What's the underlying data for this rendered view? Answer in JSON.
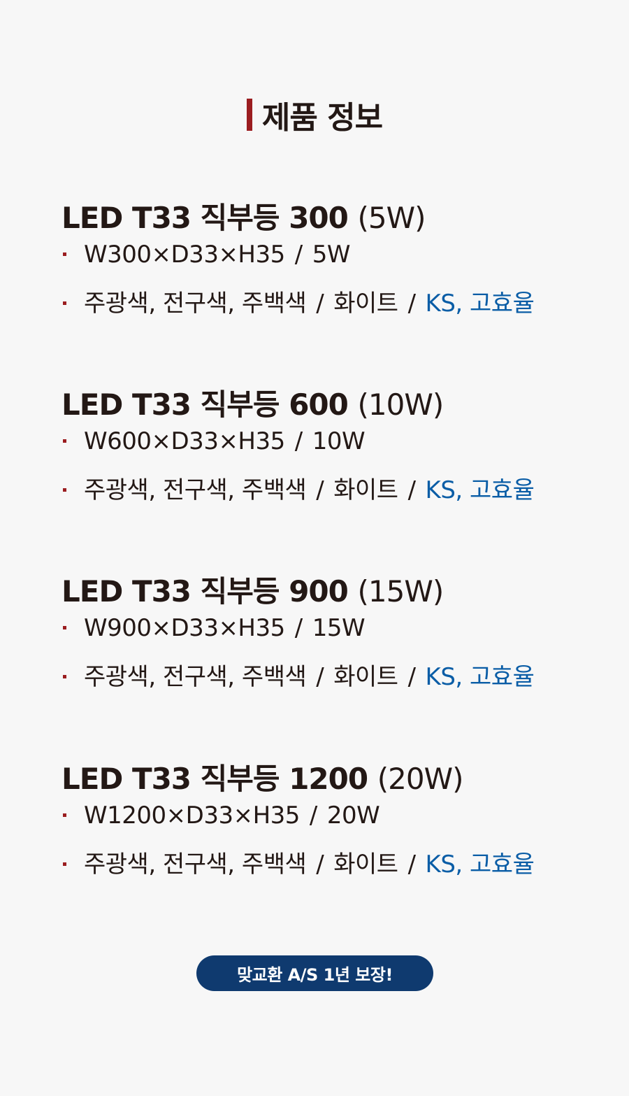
{
  "header": {
    "title": "제품 정보"
  },
  "products": [
    {
      "name": "LED T33 직부등 300",
      "watt": "(5W)",
      "size": "W300×D33×H35",
      "power": "5W",
      "colors": "주광색, 전구색, 주백색",
      "body_color": "화이트",
      "certification": "KS, 고효율"
    },
    {
      "name": "LED T33 직부등 600",
      "watt": "(10W)",
      "size": "W600×D33×H35",
      "power": "10W",
      "colors": "주광색, 전구색, 주백색",
      "body_color": "화이트",
      "certification": "KS, 고효율"
    },
    {
      "name": "LED T33 직부등 900",
      "watt": "(15W)",
      "size": "W900×D33×H35",
      "power": "15W",
      "colors": "주광색, 전구색, 주백색",
      "body_color": "화이트",
      "certification": "KS, 고효율"
    },
    {
      "name": "LED T33 직부등 1200",
      "watt": "(20W)",
      "size": "W1200×D33×H35",
      "power": "20W",
      "colors": "주광색, 전구색, 주백색",
      "body_color": "화이트",
      "certification": "KS, 고효율"
    }
  ],
  "separator": "/",
  "badge": {
    "label": "맞교환 A/S 1년 보장!"
  },
  "colors": {
    "accent_bar": "#9b1d20",
    "text": "#231815",
    "certification_text": "#0a5da6",
    "badge_background": "#0f3a6f"
  }
}
